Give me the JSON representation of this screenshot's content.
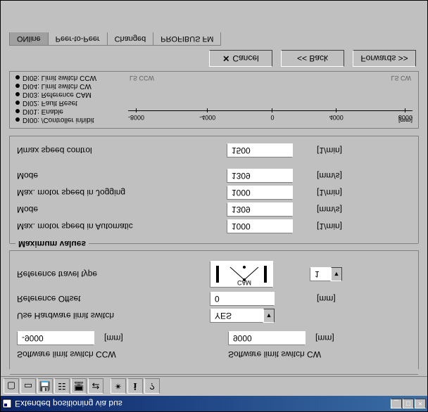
{
  "window_title": "Extended positioning via bus",
  "toolbar_icons": [
    "document",
    "open",
    "save",
    "config",
    "monitor",
    "transfer",
    "bug",
    "info",
    "help"
  ],
  "group_travel": {
    "sw_limit_ccw_label": "Software limit switch CCW",
    "sw_limit_cw_label": "Software limit switch CW",
    "sw_limit_ccw_val": "-9000",
    "sw_limit_cw_val": "9000",
    "unit_mm": "[mm]",
    "hw_limit_label": "Use Hardware limit switch",
    "hw_limit_val": "YES",
    "ref_offset_label": "Reference Offset",
    "ref_offset_val": "0",
    "ref_travel_label": "Reference travel type",
    "ref_travel_sel": "1",
    "ref_cam": "CAM"
  },
  "group_max": {
    "title": "Maximum values",
    "rows": [
      {
        "label": "Max. motor speed in Automatic",
        "val": "1000",
        "unit": "[1/min]"
      },
      {
        "label": "Mode",
        "val": "1309",
        "unit": "[mm/s]"
      },
      {
        "label": "Max. motor speed in Jogging",
        "val": "1000",
        "unit": "[1/min]"
      },
      {
        "label": "Mode",
        "val": "1309",
        "unit": "[mm/s]"
      },
      {
        "label": "Nmax speed control",
        "val": "1500",
        "unit": "[1/min]"
      }
    ]
  },
  "di": [
    "DI00: /Controller inhibit",
    "DI01: Enable",
    "DI02: Fault Reset",
    "DI03: Reference CAM",
    "DI04: Limit switch CW",
    "DI05: Limit switch CCW"
  ],
  "ruler": {
    "ticks": [
      "-8000",
      "-4000",
      "0",
      "4000",
      "8000"
    ],
    "unit": "[mm]"
  },
  "lsccw": "LS CCW",
  "lscw": "LS CW",
  "wizard": {
    "cancel": "Cancel",
    "back": "<< Back",
    "forward": "Forwards >>"
  },
  "tabs": [
    "ONline",
    "Peer-to-Peer",
    "Changed",
    "PROFIBUS FM"
  ]
}
